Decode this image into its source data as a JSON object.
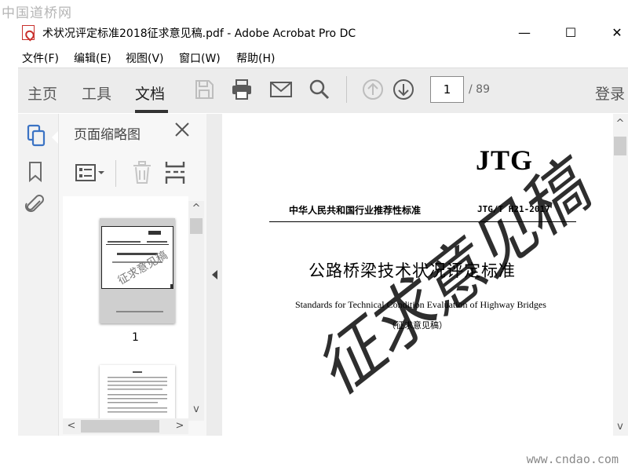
{
  "site": {
    "mark": "中国道桥网",
    "url": "www.cndao.com"
  },
  "window": {
    "title": "术状况评定标准2018征求意见稿.pdf - Adobe Acrobat Pro DC",
    "minimize": "—",
    "maximize": "☐",
    "close": "✕"
  },
  "menu": [
    {
      "label": "文件(F)"
    },
    {
      "label": "编辑(E)"
    },
    {
      "label": "视图(V)"
    },
    {
      "label": "窗口(W)"
    },
    {
      "label": "帮助(H)"
    }
  ],
  "toolbar": {
    "tabs": [
      {
        "label": "主页"
      },
      {
        "label": "工具"
      },
      {
        "label": "文档"
      }
    ],
    "active_tab": "文档",
    "page_current": "1",
    "page_total": "/ 89",
    "login": "登录",
    "icons": [
      "save-icon",
      "print-icon",
      "email-icon",
      "search-icon",
      "page-up-icon",
      "page-down-icon"
    ]
  },
  "rail": {
    "icons": [
      "pages-icon",
      "bookmark-icon",
      "attachment-icon"
    ]
  },
  "panel": {
    "title": "页面缩略图",
    "thumbnails": [
      {
        "label": "1"
      }
    ],
    "icons": [
      "thumbnail-options-icon",
      "delete-icon",
      "insert-page-icon"
    ]
  },
  "document": {
    "series": "JTG",
    "standard_type": "中华人民共和国行业推荐性标准",
    "standard_code": "JTG/T H21-2017",
    "title": "公路桥梁技术状况评定标准",
    "subtitle": "Standards for Technical Condition Evaluation of Highway Bridges",
    "draft_note": "（征求意见稿）",
    "watermark": "征求意见稿"
  },
  "colors": {
    "toolbar_bg": "#ececec",
    "icon_blue": "#3b73c4",
    "icon_gray": "#5a5a5a"
  }
}
